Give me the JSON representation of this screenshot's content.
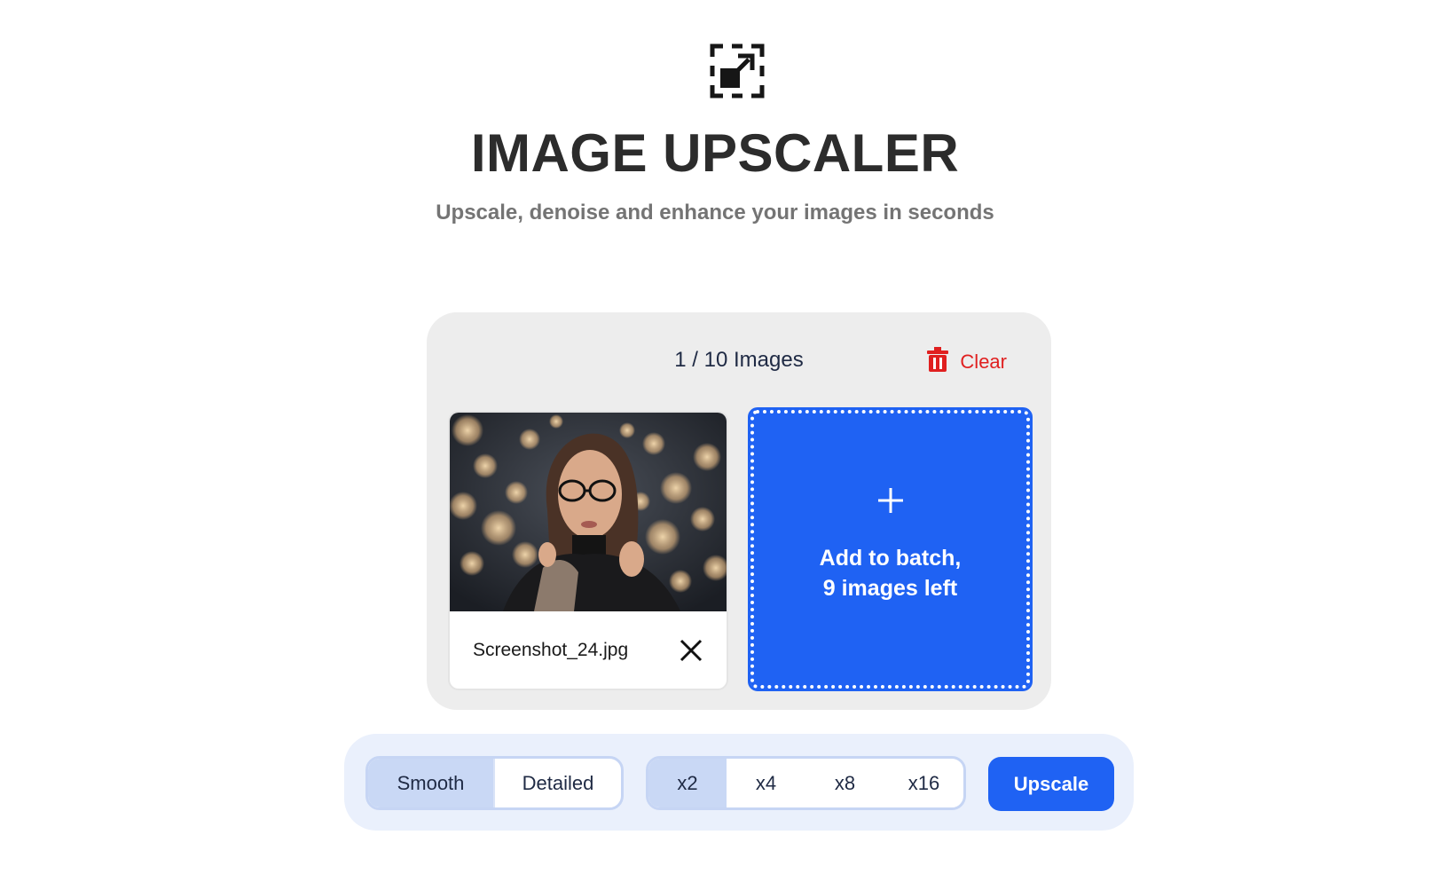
{
  "header": {
    "logo_icon": "expand-arrow-icon",
    "title": "IMAGE UPSCALER",
    "subtitle": "Upscale, denoise and enhance your images in seconds"
  },
  "batch": {
    "count_label": "1 / 10 Images",
    "clear_label": "Clear",
    "clear_icon": "trash-icon",
    "items": [
      {
        "file_name": "Screenshot_24.jpg",
        "remove_icon": "close-icon"
      }
    ],
    "add_tile": {
      "icon": "plus-icon",
      "line1": "Add to batch,",
      "line2": "9 images left"
    }
  },
  "controls": {
    "mode_options": [
      {
        "label": "Smooth",
        "selected": true
      },
      {
        "label": "Detailed",
        "selected": false
      }
    ],
    "scale_options": [
      {
        "label": "x2",
        "selected": true
      },
      {
        "label": "x4",
        "selected": false
      },
      {
        "label": "x8",
        "selected": false
      },
      {
        "label": "x16",
        "selected": false
      }
    ],
    "upscale_label": "Upscale"
  },
  "colors": {
    "accent": "#1f62f3",
    "danger": "#e02020",
    "panel_bg": "#ededed",
    "controls_bg": "#eaf0fc",
    "selected_bg": "#c9d8f5"
  }
}
